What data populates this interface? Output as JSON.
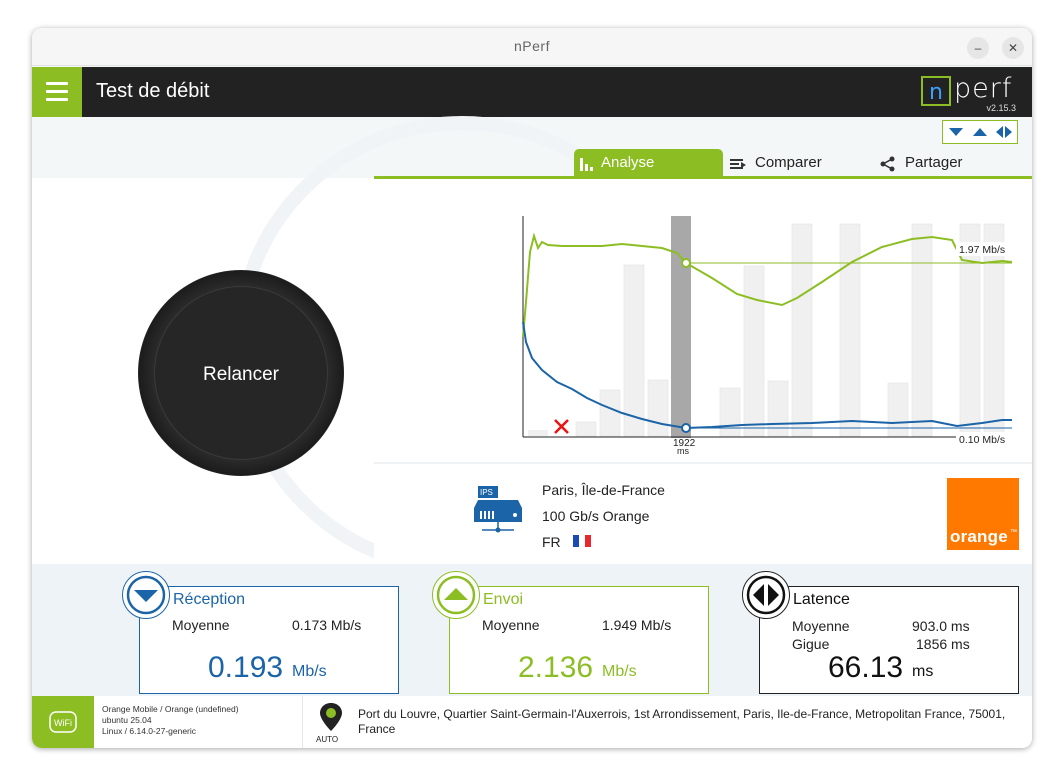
{
  "window": {
    "title": "nPerf",
    "minimize": "–",
    "close": "✕"
  },
  "appbar": {
    "title": "Test de débit",
    "logo_text": "perf",
    "logo_n": "n",
    "version": "v2.15.3"
  },
  "tabs": [
    {
      "label": "Analyse",
      "icon": "bar-chart-icon",
      "active": true
    },
    {
      "label": "Comparer",
      "icon": "compare-icon",
      "active": false
    },
    {
      "label": "Partager",
      "icon": "share-icon",
      "active": false
    }
  ],
  "relaunch": {
    "label": "Relancer"
  },
  "chart_data": {
    "type": "line",
    "marker_label": "1922",
    "marker_unit": "ms",
    "label_high": "1.97 Mb/s",
    "label_low": "0.10 Mb/s",
    "series": [
      {
        "name": "Envoi",
        "color": "#8cbe24"
      },
      {
        "name": "Réception",
        "color": "#1b64a8"
      }
    ]
  },
  "server": {
    "badge": "IPS",
    "city": "Paris, Île-de-France",
    "link": "100 Gb/s Orange",
    "country": "FR"
  },
  "operator": {
    "name": "orange",
    "tm": "™",
    "color": "#ff7900"
  },
  "reception": {
    "title": "Réception",
    "avg_label": "Moyenne",
    "avg_value": "0.173 Mb/s",
    "value": "0.193",
    "unit": "Mb/s",
    "color": "#1b64a8"
  },
  "envoi": {
    "title": "Envoi",
    "avg_label": "Moyenne",
    "avg_value": "1.949 Mb/s",
    "value": "2.136",
    "unit": "Mb/s",
    "color": "#8cbe24"
  },
  "latence": {
    "title": "Latence",
    "avg_label": "Moyenne",
    "avg_value": "903.0 ms",
    "jitter_label": "Gigue",
    "jitter_value": "1856 ms",
    "value": "66.13",
    "unit": "ms",
    "color": "#111111"
  },
  "footer": {
    "wifi_label": "WiFi",
    "net_line1": "Orange Mobile / Orange (undefined)",
    "net_line2": "ubuntu 25.04",
    "net_line3": "Linux / 6.14.0-27-generic",
    "pin_label": "AUTO",
    "address": "Port du Louvre, Quartier Saint-Germain-l'Auxerrois, 1st Arrondissement, Paris, Ile-de-France, Metropolitan France, 75001, France"
  }
}
